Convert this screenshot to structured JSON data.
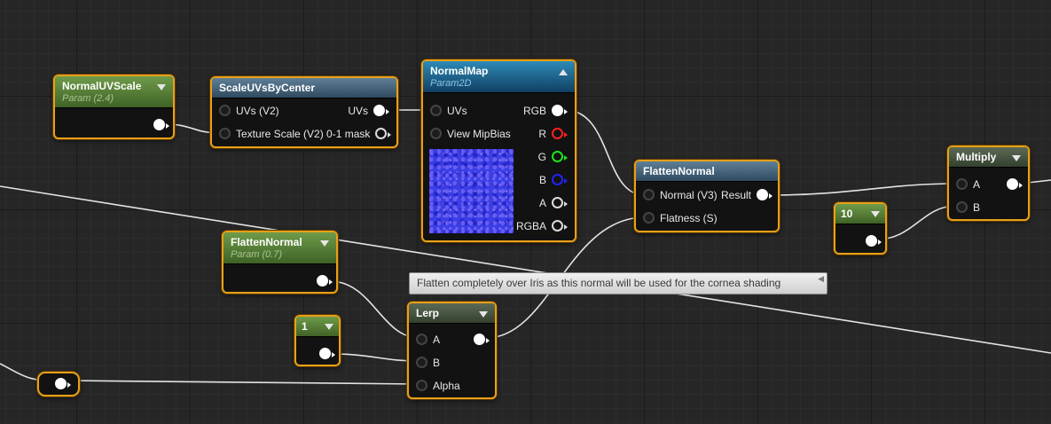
{
  "nodes": {
    "normal_uv_scale": {
      "title": "NormalUVScale",
      "subtitle": "Param (2.4)"
    },
    "scale_uvs": {
      "title": "ScaleUVsByCenter",
      "in1": "UVs (V2)",
      "in2": "Texture Scale (V2) 0-1 mask",
      "out1": "UVs"
    },
    "normal_map": {
      "title": "NormalMap",
      "subtitle": "Param2D",
      "in1": "UVs",
      "in2": "View MipBias",
      "out_rgb": "RGB",
      "out_r": "R",
      "out_g": "G",
      "out_b": "B",
      "out_a": "A",
      "out_rgba": "RGBA"
    },
    "flatten_normal_fn": {
      "title": "FlattenNormal",
      "in1": "Normal (V3)",
      "out1": "Result",
      "in2": "Flatness (S)"
    },
    "flatten_normal_param": {
      "title": "FlattenNormal",
      "subtitle": "Param (0.7)"
    },
    "const_1": {
      "title": "1"
    },
    "lerp": {
      "title": "Lerp",
      "in_a": "A",
      "in_b": "B",
      "in_alpha": "Alpha"
    },
    "const_10": {
      "title": "10"
    },
    "multiply": {
      "title": "Multiply",
      "in_a": "A",
      "in_b": "B"
    }
  },
  "tooltip": "Flatten completely over Iris as this normal will be used for the cornea shading",
  "colors": {
    "selected_border": "#e8a018",
    "background": "#262626",
    "wire": "#e6e6e6",
    "param_header": "#5a8a3a",
    "function_header": "#3c5a6e",
    "texture_header": "#1f6a94"
  }
}
